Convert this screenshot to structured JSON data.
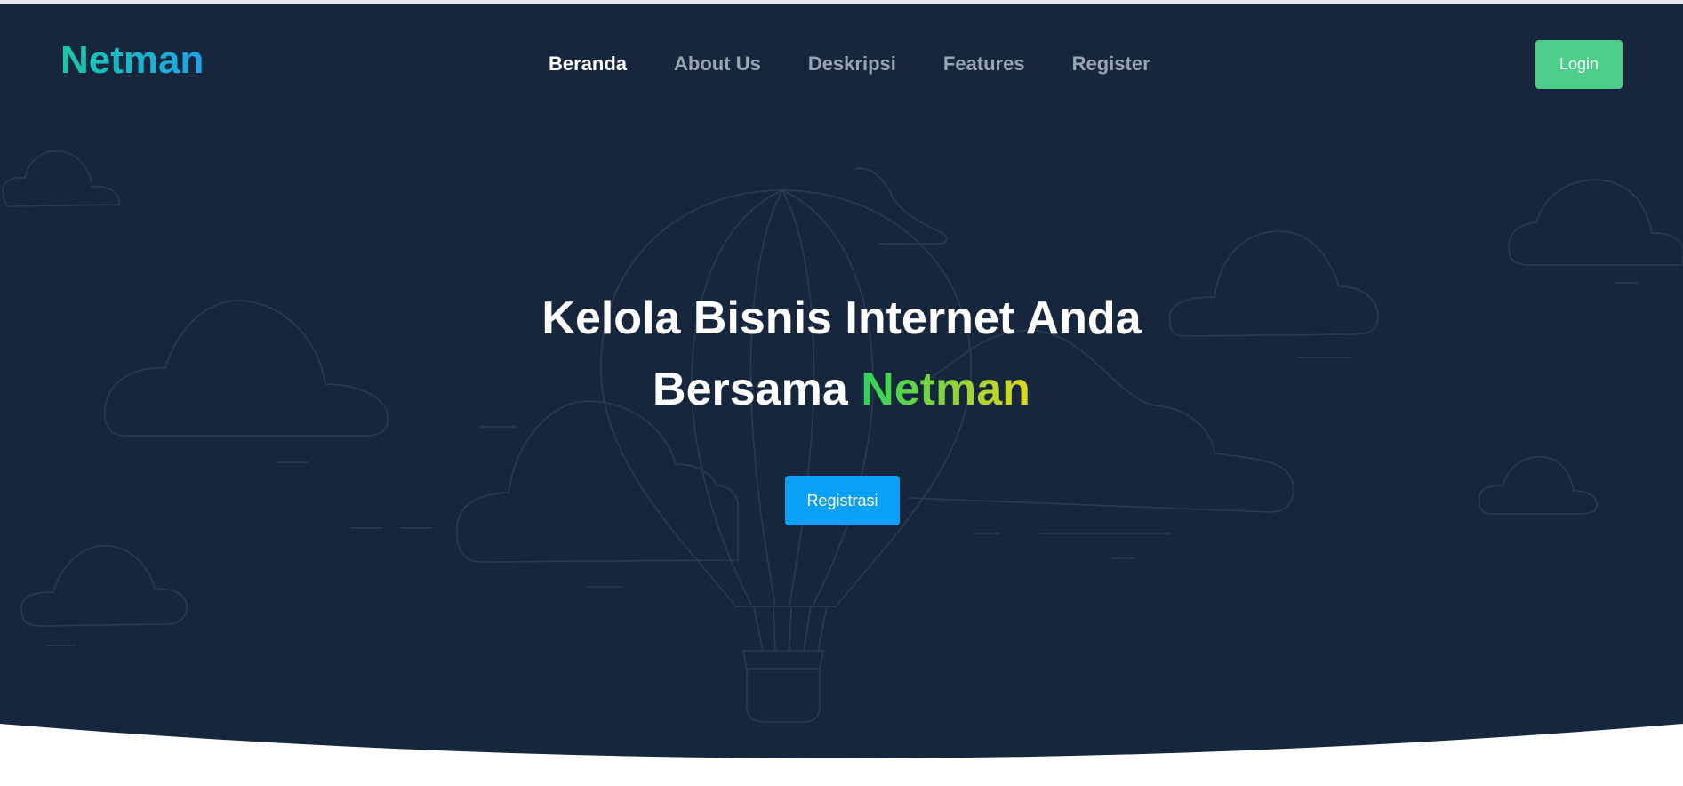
{
  "brand": {
    "logo_text": "Netman",
    "logo_colors": [
      "#19c8a8",
      "#1ea4ea"
    ]
  },
  "nav": {
    "items": [
      {
        "label": "Beranda",
        "active": true
      },
      {
        "label": "About Us",
        "active": false
      },
      {
        "label": "Deskripsi",
        "active": false
      },
      {
        "label": "Features",
        "active": false
      },
      {
        "label": "Register",
        "active": false
      }
    ],
    "login_label": "Login"
  },
  "hero": {
    "headline_line1": "Kelola Bisnis Internet Anda",
    "headline_line2_prefix": "Bersama",
    "headline_line2_brand": "Netman",
    "cta_label": "Registrasi",
    "background_icon": "hot-air-balloon-and-clouds-illustration"
  },
  "colors": {
    "hero_bg": "#16263d",
    "nav_active": "#ffffff",
    "nav_inactive": "#9aa3b2",
    "login_button": "#4ccd89",
    "cta_button": "#0aa0f5",
    "brand_gradient": [
      "#2bd35a",
      "#8fd43a",
      "#e2d81f"
    ]
  }
}
